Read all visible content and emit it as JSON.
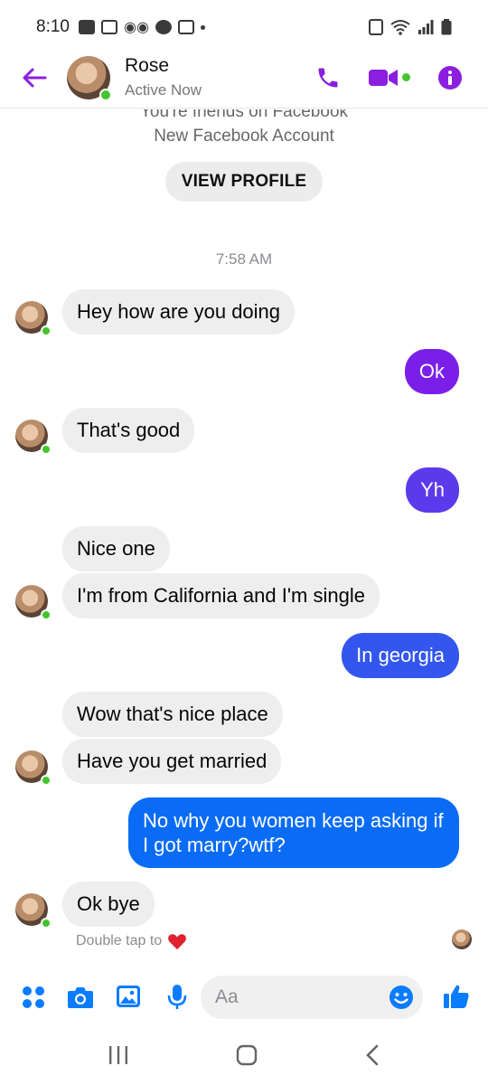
{
  "status_bar": {
    "time": "8:10"
  },
  "header": {
    "name": "Rose",
    "status": "Active Now"
  },
  "intro": {
    "friends_text": "You're friends on Facebook",
    "account_text": "New Facebook Account",
    "view_profile_label": "VIEW PROFILE"
  },
  "timestamp": "7:58 AM",
  "messages": [
    {
      "side": "in",
      "text": "Hey how are you doing"
    },
    {
      "side": "out",
      "text": "Ok"
    },
    {
      "side": "in",
      "text": "That's good"
    },
    {
      "side": "out",
      "text": "Yh"
    },
    {
      "side": "in",
      "text": "Nice one"
    },
    {
      "side": "in",
      "text": "I'm from California and I'm single"
    },
    {
      "side": "out",
      "text": "In georgia"
    },
    {
      "side": "in",
      "text": "Wow that's nice place"
    },
    {
      "side": "in",
      "text": "Have you get married"
    },
    {
      "side": "out",
      "text": "No why you women keep asking if I got marry?wtf?"
    },
    {
      "side": "in",
      "text": "Ok bye"
    }
  ],
  "double_tap_text": "Double tap to",
  "composer": {
    "placeholder": "Aa"
  },
  "icons": {
    "back": "arrow-left-icon",
    "call": "phone-icon",
    "video": "video-camera-icon",
    "info": "info-icon",
    "more": "four-dots-icon",
    "camera": "camera-icon",
    "gallery": "image-icon",
    "mic": "microphone-icon",
    "emoji": "smiley-icon",
    "like": "thumbs-up-icon",
    "heart": "heart-icon"
  },
  "colors": {
    "accent_purple": "#8a1fe0",
    "accent_blue": "#0a7cff",
    "online_green": "#44c42d",
    "incoming_bubble": "#eeeeee"
  }
}
